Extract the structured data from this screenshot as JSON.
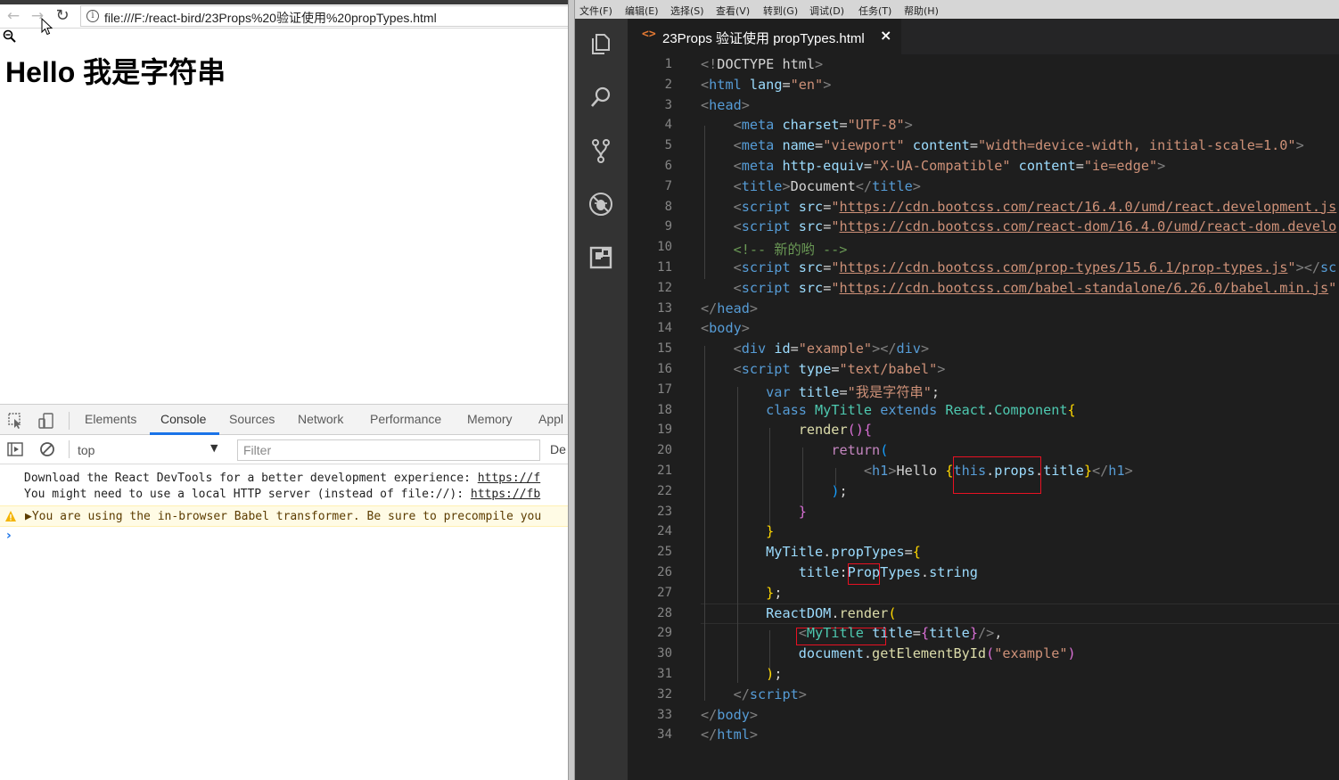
{
  "browser": {
    "url": "file:///F:/react-bird/23Props%20验证使用%20propTypes.html",
    "page_heading": "Hello 我是字符串",
    "devtools": {
      "tabs": [
        "Elements",
        "Console",
        "Sources",
        "Network",
        "Performance",
        "Memory",
        "Appl"
      ],
      "active_tab": "Console",
      "context": "top",
      "filter_placeholder": "Filter",
      "extra_label": "De",
      "messages": [
        {
          "text": "Download the React DevTools for a better development experience: ",
          "link": "https://f"
        },
        {
          "text": "You might need to use a local HTTP server (instead of file://): ",
          "link": "https://fb"
        }
      ],
      "warning": "You are using the in-browser Babel transformer. Be sure to precompile you"
    }
  },
  "editor": {
    "menu": [
      "文件(F)",
      "编辑(E)",
      "选择(S)",
      "查看(V)",
      "转到(G)",
      "调试(D)",
      "任务(T)",
      "帮助(H)"
    ],
    "tab_title": "23Props 验证使用 propTypes.html",
    "tab_close": "×",
    "tab_icon": "<>",
    "activity_icons": [
      "explorer-icon",
      "search-icon",
      "source-control-icon",
      "debug-icon",
      "extensions-icon"
    ],
    "line_numbers": [
      "1",
      "2",
      "3",
      "4",
      "5",
      "6",
      "7",
      "8",
      "9",
      "10",
      "11",
      "12",
      "13",
      "14",
      "15",
      "16",
      "17",
      "18",
      "19",
      "20",
      "21",
      "22",
      "23",
      "24",
      "25",
      "26",
      "27",
      "28",
      "29",
      "30",
      "31",
      "32",
      "33",
      "34"
    ],
    "code": [
      [
        [
          "br",
          "<!"
        ],
        [
          "txt",
          "DOCTYPE html"
        ],
        [
          "br",
          ">"
        ]
      ],
      [
        [
          "br",
          "<"
        ],
        [
          "tag",
          "html"
        ],
        [
          "txt",
          " "
        ],
        [
          "attr",
          "lang"
        ],
        [
          "txt",
          "="
        ],
        [
          "str",
          "\"en\""
        ],
        [
          "br",
          ">"
        ]
      ],
      [
        [
          "br",
          "<"
        ],
        [
          "tag",
          "head"
        ],
        [
          "br",
          ">"
        ]
      ],
      [
        [
          "txt",
          "    "
        ],
        [
          "br",
          "<"
        ],
        [
          "tag",
          "meta"
        ],
        [
          "txt",
          " "
        ],
        [
          "attr",
          "charset"
        ],
        [
          "txt",
          "="
        ],
        [
          "str",
          "\"UTF-8\""
        ],
        [
          "br",
          ">"
        ]
      ],
      [
        [
          "txt",
          "    "
        ],
        [
          "br",
          "<"
        ],
        [
          "tag",
          "meta"
        ],
        [
          "txt",
          " "
        ],
        [
          "attr",
          "name"
        ],
        [
          "txt",
          "="
        ],
        [
          "str",
          "\"viewport\""
        ],
        [
          "txt",
          " "
        ],
        [
          "attr",
          "content"
        ],
        [
          "txt",
          "="
        ],
        [
          "str",
          "\"width=device-width, initial-scale=1.0\""
        ],
        [
          "br",
          ">"
        ]
      ],
      [
        [
          "txt",
          "    "
        ],
        [
          "br",
          "<"
        ],
        [
          "tag",
          "meta"
        ],
        [
          "txt",
          " "
        ],
        [
          "attr",
          "http-equiv"
        ],
        [
          "txt",
          "="
        ],
        [
          "str",
          "\"X-UA-Compatible\""
        ],
        [
          "txt",
          " "
        ],
        [
          "attr",
          "content"
        ],
        [
          "txt",
          "="
        ],
        [
          "str",
          "\"ie=edge\""
        ],
        [
          "br",
          ">"
        ]
      ],
      [
        [
          "txt",
          "    "
        ],
        [
          "br",
          "<"
        ],
        [
          "tag",
          "title"
        ],
        [
          "br",
          ">"
        ],
        [
          "txt",
          "Document"
        ],
        [
          "br",
          "</"
        ],
        [
          "tag",
          "title"
        ],
        [
          "br",
          ">"
        ]
      ],
      [
        [
          "txt",
          "    "
        ],
        [
          "br",
          "<"
        ],
        [
          "tag",
          "script"
        ],
        [
          "txt",
          " "
        ],
        [
          "attr",
          "src"
        ],
        [
          "txt",
          "="
        ],
        [
          "str",
          "\""
        ],
        [
          "url",
          "https://cdn.bootcss.com/react/16.4.0/umd/react.development.js"
        ]
      ],
      [
        [
          "txt",
          "    "
        ],
        [
          "br",
          "<"
        ],
        [
          "tag",
          "script"
        ],
        [
          "txt",
          " "
        ],
        [
          "attr",
          "src"
        ],
        [
          "txt",
          "="
        ],
        [
          "str",
          "\""
        ],
        [
          "url",
          "https://cdn.bootcss.com/react-dom/16.4.0/umd/react-dom.develo"
        ]
      ],
      [
        [
          "txt",
          "    "
        ],
        [
          "cmt",
          "<!-- 新的哟 -->"
        ]
      ],
      [
        [
          "txt",
          "    "
        ],
        [
          "br",
          "<"
        ],
        [
          "tag",
          "script"
        ],
        [
          "txt",
          " "
        ],
        [
          "attr",
          "src"
        ],
        [
          "txt",
          "="
        ],
        [
          "str",
          "\""
        ],
        [
          "url",
          "https://cdn.bootcss.com/prop-types/15.6.1/prop-types.js"
        ],
        [
          "str",
          "\""
        ],
        [
          "br",
          "></"
        ],
        [
          "tag",
          "sc"
        ]
      ],
      [
        [
          "txt",
          "    "
        ],
        [
          "br",
          "<"
        ],
        [
          "tag",
          "script"
        ],
        [
          "txt",
          " "
        ],
        [
          "attr",
          "src"
        ],
        [
          "txt",
          "="
        ],
        [
          "str",
          "\""
        ],
        [
          "url",
          "https://cdn.bootcss.com/babel-standalone/6.26.0/babel.min.js"
        ],
        [
          "str",
          "\""
        ]
      ],
      [
        [
          "br",
          "</"
        ],
        [
          "tag",
          "head"
        ],
        [
          "br",
          ">"
        ]
      ],
      [
        [
          "br",
          "<"
        ],
        [
          "tag",
          "body"
        ],
        [
          "br",
          ">"
        ]
      ],
      [
        [
          "txt",
          "    "
        ],
        [
          "br",
          "<"
        ],
        [
          "tag",
          "div"
        ],
        [
          "txt",
          " "
        ],
        [
          "attr",
          "id"
        ],
        [
          "txt",
          "="
        ],
        [
          "str",
          "\"example\""
        ],
        [
          "br",
          "></"
        ],
        [
          "tag",
          "div"
        ],
        [
          "br",
          ">"
        ]
      ],
      [
        [
          "txt",
          "    "
        ],
        [
          "br",
          "<"
        ],
        [
          "tag",
          "script"
        ],
        [
          "txt",
          " "
        ],
        [
          "attr",
          "type"
        ],
        [
          "txt",
          "="
        ],
        [
          "str",
          "\"text/babel\""
        ],
        [
          "br",
          ">"
        ]
      ],
      [
        [
          "txt",
          "        "
        ],
        [
          "kw",
          "var"
        ],
        [
          "txt",
          " "
        ],
        [
          "var",
          "title"
        ],
        [
          "txt",
          "="
        ],
        [
          "str",
          "\"我是字符串\""
        ],
        [
          "txt",
          ";"
        ]
      ],
      [
        [
          "txt",
          "        "
        ],
        [
          "kw",
          "class"
        ],
        [
          "txt",
          " "
        ],
        [
          "cls",
          "MyTitle"
        ],
        [
          "txt",
          " "
        ],
        [
          "kw",
          "extends"
        ],
        [
          "txt",
          " "
        ],
        [
          "cls",
          "React"
        ],
        [
          "txt",
          "."
        ],
        [
          "cls",
          "Component"
        ],
        [
          "brace",
          "{"
        ]
      ],
      [
        [
          "txt",
          "            "
        ],
        [
          "fn",
          "render"
        ],
        [
          "brace2",
          "()"
        ],
        [
          "brace2",
          "{"
        ]
      ],
      [
        [
          "txt",
          "                "
        ],
        [
          "ctl",
          "return"
        ],
        [
          "brace3",
          "("
        ]
      ],
      [
        [
          "txt",
          "                    "
        ],
        [
          "br",
          "<"
        ],
        [
          "tag",
          "h1"
        ],
        [
          "br",
          ">"
        ],
        [
          "txt",
          "Hello "
        ],
        [
          "brace",
          "{"
        ],
        [
          "kw",
          "this"
        ],
        [
          "txt",
          "."
        ],
        [
          "var",
          "props"
        ],
        [
          "txt",
          "."
        ],
        [
          "var",
          "title"
        ],
        [
          "brace",
          "}"
        ],
        [
          "br",
          "</"
        ],
        [
          "tag",
          "h1"
        ],
        [
          "br",
          ">"
        ]
      ],
      [
        [
          "txt",
          "                "
        ],
        [
          "brace3",
          ")"
        ],
        [
          "txt",
          ";"
        ]
      ],
      [
        [
          "txt",
          "            "
        ],
        [
          "brace2",
          "}"
        ]
      ],
      [
        [
          "txt",
          "        "
        ],
        [
          "brace",
          "}"
        ]
      ],
      [
        [
          "txt",
          "        "
        ],
        [
          "var",
          "MyTitle"
        ],
        [
          "txt",
          "."
        ],
        [
          "var",
          "propTypes"
        ],
        [
          "txt",
          "="
        ],
        [
          "brace",
          "{"
        ]
      ],
      [
        [
          "txt",
          "            "
        ],
        [
          "var",
          "title"
        ],
        [
          "txt",
          ":"
        ],
        [
          "var",
          "PropTypes"
        ],
        [
          "txt",
          "."
        ],
        [
          "var",
          "string"
        ]
      ],
      [
        [
          "txt",
          "        "
        ],
        [
          "brace",
          "}"
        ],
        [
          "txt",
          ";"
        ]
      ],
      [
        [
          "txt",
          "        "
        ],
        [
          "var",
          "ReactDOM"
        ],
        [
          "txt",
          "."
        ],
        [
          "fn",
          "render"
        ],
        [
          "brace",
          "("
        ]
      ],
      [
        [
          "txt",
          "            "
        ],
        [
          "br",
          "<"
        ],
        [
          "cls",
          "MyTitle"
        ],
        [
          "txt",
          " "
        ],
        [
          "attr",
          "title"
        ],
        [
          "txt",
          "="
        ],
        [
          "brace2",
          "{"
        ],
        [
          "var",
          "title"
        ],
        [
          "brace2",
          "}"
        ],
        [
          "br",
          "/>"
        ],
        [
          "txt",
          ","
        ]
      ],
      [
        [
          "txt",
          "            "
        ],
        [
          "var",
          "document"
        ],
        [
          "txt",
          "."
        ],
        [
          "fn",
          "getElementById"
        ],
        [
          "brace2",
          "("
        ],
        [
          "str",
          "\"example\""
        ],
        [
          "brace2",
          ")"
        ]
      ],
      [
        [
          "txt",
          "        "
        ],
        [
          "brace",
          ")"
        ],
        [
          "txt",
          ";"
        ]
      ],
      [
        [
          "txt",
          "    "
        ],
        [
          "br",
          "</"
        ],
        [
          "tag",
          "script"
        ],
        [
          "br",
          ">"
        ]
      ],
      [
        [
          "br",
          "</"
        ],
        [
          "tag",
          "body"
        ],
        [
          "br",
          ">"
        ]
      ],
      [
        [
          "br",
          "</"
        ],
        [
          "tag",
          "html"
        ],
        [
          "br",
          ">"
        ]
      ]
    ]
  }
}
